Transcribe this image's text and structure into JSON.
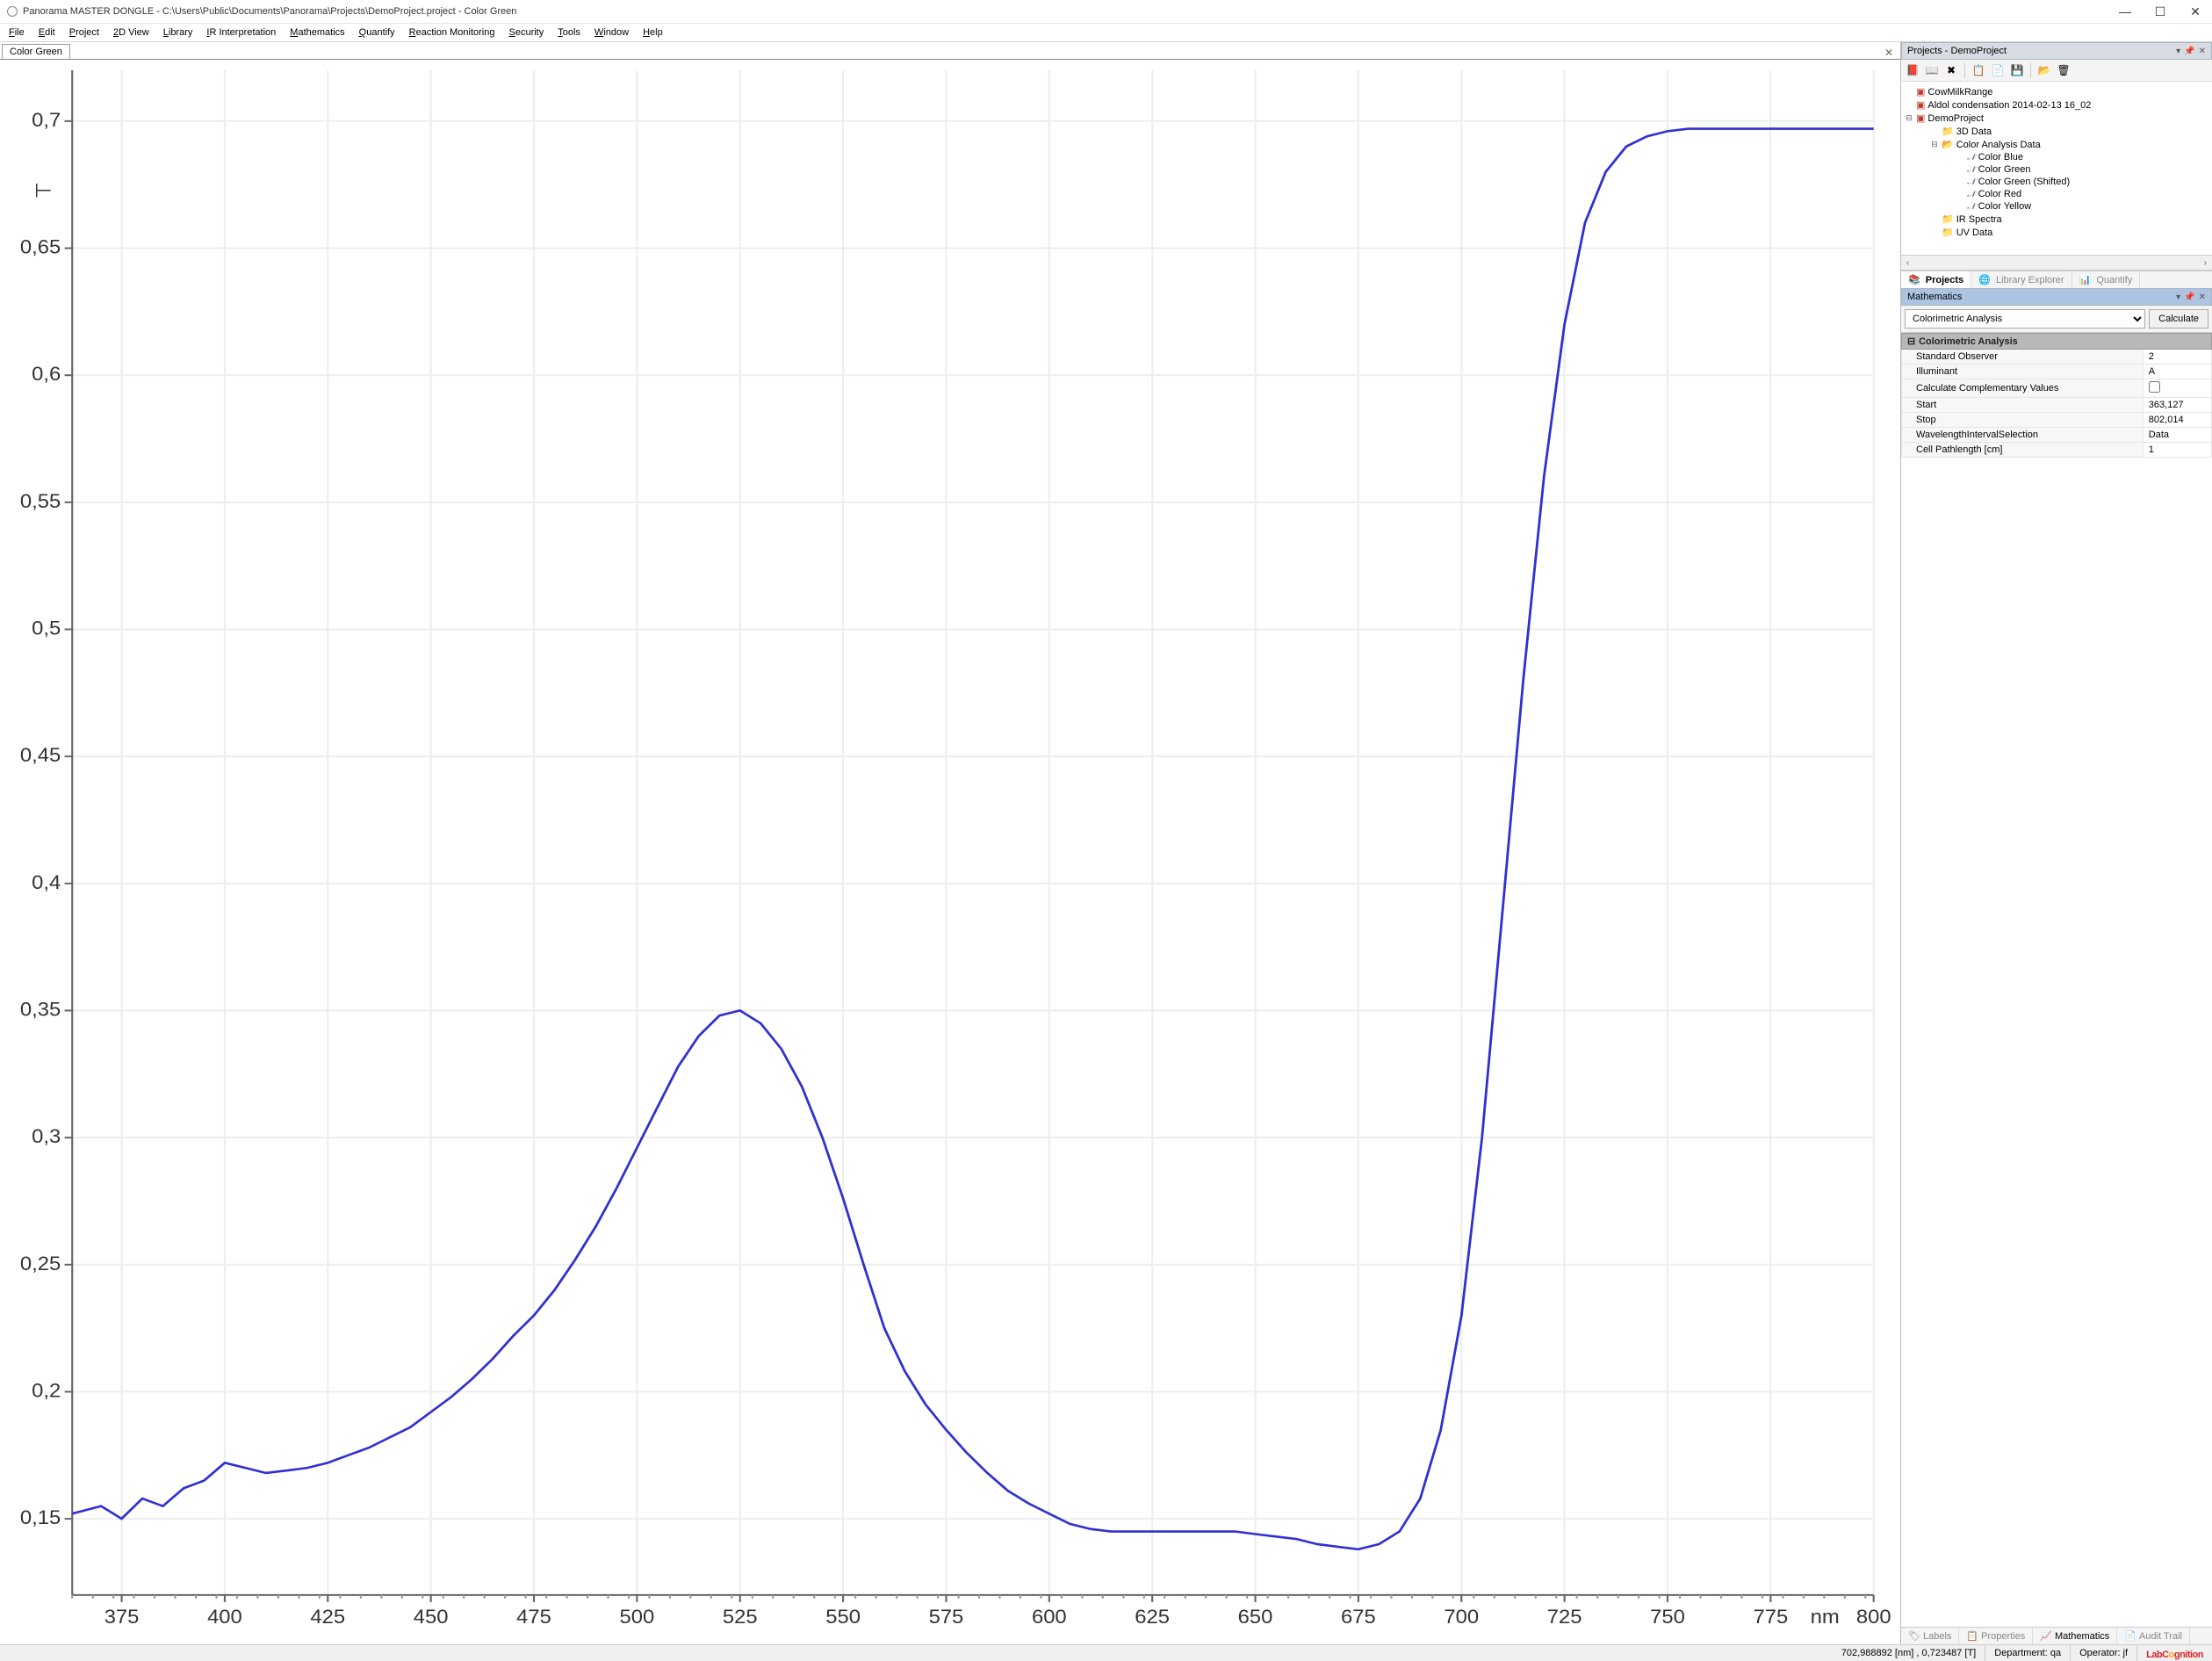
{
  "titlebar": {
    "title": "Panorama MASTER DONGLE - C:\\Users\\Public\\Documents\\Panorama\\Projects\\DemoProject.project - Color Green"
  },
  "menu": {
    "items": [
      "File",
      "Edit",
      "Project",
      "2D View",
      "Library",
      "IR Interpretation",
      "Mathematics",
      "Quantify",
      "Reaction Monitoring",
      "Security",
      "Tools",
      "Window",
      "Help"
    ]
  },
  "tab": {
    "label": "Color Green"
  },
  "projects": {
    "title": "Projects - DemoProject",
    "tree": [
      {
        "label": "CowMilkRange",
        "type": "project",
        "expanded": false
      },
      {
        "label": "Aldol condensation 2014-02-13 16_02",
        "type": "project",
        "expanded": false
      },
      {
        "label": "DemoProject",
        "type": "project",
        "expanded": true,
        "children": [
          {
            "label": "3D Data",
            "type": "folder",
            "expanded": false
          },
          {
            "label": "Color Analysis Data",
            "type": "folder",
            "expanded": true,
            "children": [
              {
                "label": "Color Blue",
                "type": "data"
              },
              {
                "label": "Color Green",
                "type": "data"
              },
              {
                "label": "Color Green (Shifted)",
                "type": "data"
              },
              {
                "label": "Color Red",
                "type": "data"
              },
              {
                "label": "Color Yellow",
                "type": "data"
              }
            ]
          },
          {
            "label": "IR Spectra",
            "type": "folder",
            "expanded": false
          },
          {
            "label": "UV Data",
            "type": "folder",
            "expanded": false
          }
        ]
      }
    ],
    "tabs": {
      "projects": "Projects",
      "library": "Library Explorer",
      "quantify": "Quantify"
    }
  },
  "math": {
    "title": "Mathematics",
    "selected": "Colorimetric Analysis",
    "calc": "Calculate",
    "header": "Colorimetric Analysis",
    "rows": [
      {
        "name": "Standard Observer",
        "value": "2"
      },
      {
        "name": "Illuminant",
        "value": "A"
      },
      {
        "name": "Calculate Complementary Values",
        "value": "checkbox:false"
      },
      {
        "name": "Start",
        "value": "363,127"
      },
      {
        "name": "Stop",
        "value": "802,014"
      },
      {
        "name": "WavelengthIntervalSelection",
        "value": "Data"
      },
      {
        "name": "Cell Pathlength [cm]",
        "value": "1"
      }
    ]
  },
  "bottomtabs": {
    "labels": "Labels",
    "properties": "Properties",
    "mathematics": "Mathematics",
    "audit": "Audit Trail"
  },
  "status": {
    "coord": "702,988892 [nm] , 0,723487 [T]",
    "dept": "Department: qa",
    "op": "Operator: jf"
  },
  "chart_data": {
    "type": "line",
    "title": "Color Green",
    "xlabel": "nm",
    "ylabel": "",
    "xlim": [
      363,
      800
    ],
    "ylim": [
      0.12,
      0.72
    ],
    "x_ticks": [
      375,
      400,
      425,
      450,
      475,
      500,
      525,
      550,
      575,
      600,
      625,
      650,
      675,
      700,
      725,
      750,
      775,
      800
    ],
    "y_ticks": [
      0.15,
      0.2,
      0.25,
      0.3,
      0.35,
      0.4,
      0.45,
      0.5,
      0.55,
      0.6,
      0.65,
      0.7
    ],
    "series": [
      {
        "name": "Color Green",
        "color": "#3030d0",
        "x": [
          363,
          370,
          375,
          380,
          385,
          390,
          395,
          400,
          405,
          410,
          415,
          420,
          425,
          430,
          435,
          440,
          445,
          450,
          455,
          460,
          465,
          470,
          475,
          480,
          485,
          490,
          495,
          500,
          505,
          510,
          515,
          520,
          525,
          530,
          535,
          540,
          545,
          550,
          555,
          560,
          565,
          570,
          575,
          580,
          585,
          590,
          595,
          600,
          605,
          610,
          615,
          620,
          625,
          630,
          635,
          640,
          645,
          650,
          655,
          660,
          665,
          670,
          675,
          680,
          685,
          690,
          695,
          700,
          705,
          710,
          715,
          720,
          725,
          730,
          735,
          740,
          745,
          750,
          755,
          760,
          765,
          770,
          775,
          780,
          785,
          790,
          795,
          800
        ],
        "y": [
          0.152,
          0.155,
          0.15,
          0.158,
          0.155,
          0.162,
          0.165,
          0.172,
          0.17,
          0.168,
          0.169,
          0.17,
          0.172,
          0.175,
          0.178,
          0.182,
          0.186,
          0.192,
          0.198,
          0.205,
          0.213,
          0.222,
          0.23,
          0.24,
          0.252,
          0.265,
          0.28,
          0.296,
          0.312,
          0.328,
          0.34,
          0.348,
          0.35,
          0.345,
          0.335,
          0.32,
          0.3,
          0.276,
          0.25,
          0.225,
          0.208,
          0.195,
          0.185,
          0.176,
          0.168,
          0.161,
          0.156,
          0.152,
          0.148,
          0.146,
          0.145,
          0.145,
          0.145,
          0.145,
          0.145,
          0.145,
          0.145,
          0.144,
          0.143,
          0.142,
          0.14,
          0.139,
          0.138,
          0.14,
          0.145,
          0.158,
          0.185,
          0.23,
          0.3,
          0.39,
          0.48,
          0.56,
          0.62,
          0.66,
          0.68,
          0.69,
          0.694,
          0.696,
          0.697,
          0.697,
          0.697,
          0.697,
          0.697,
          0.697,
          0.697,
          0.697,
          0.697,
          0.697
        ]
      }
    ]
  }
}
